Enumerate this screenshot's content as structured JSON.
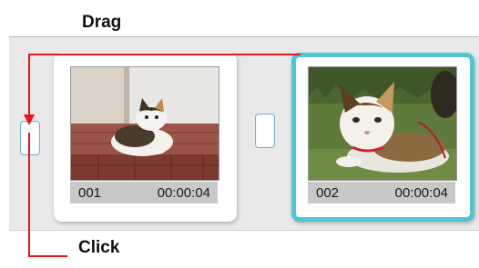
{
  "annotations": {
    "drag_label": "Drag",
    "click_label": "Click"
  },
  "colors": {
    "arrow": "#e8151b",
    "selection_border": "#4ec6d8",
    "timeline_bg": "#e9e9e9"
  },
  "clips": [
    {
      "number": "001",
      "duration": "00:00:04",
      "selected": false
    },
    {
      "number": "002",
      "duration": "00:00:04",
      "selected": true
    }
  ],
  "icons": {
    "arrow": "red-arrow-icon"
  }
}
